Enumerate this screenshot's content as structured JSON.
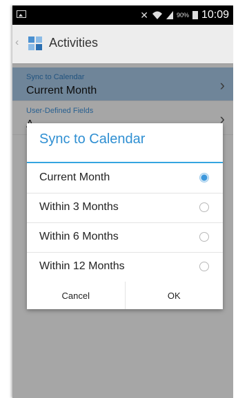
{
  "status_bar": {
    "battery_percent": "90%",
    "time": "10:09",
    "icons": [
      "picture-icon",
      "mute-icon",
      "wifi-icon",
      "signal-icon",
      "battery-icon"
    ]
  },
  "action_bar": {
    "back_glyph": "‹",
    "title": "Activities"
  },
  "settings": [
    {
      "caption": "Sync to Calendar",
      "value": "Current Month",
      "selected": true
    },
    {
      "caption": "User-Defined Fields",
      "value": "A",
      "selected": false
    }
  ],
  "dialog": {
    "title": "Sync to Calendar",
    "options": [
      {
        "label": "Current Month",
        "checked": true
      },
      {
        "label": "Within 3 Months",
        "checked": false
      },
      {
        "label": "Within 6 Months",
        "checked": false
      },
      {
        "label": "Within 12 Months",
        "checked": false
      }
    ],
    "cancel_label": "Cancel",
    "ok_label": "OK"
  },
  "colors": {
    "accent": "#33a4e0",
    "title_blue": "#2f8fd2",
    "selected_row": "#9ab9d4"
  }
}
